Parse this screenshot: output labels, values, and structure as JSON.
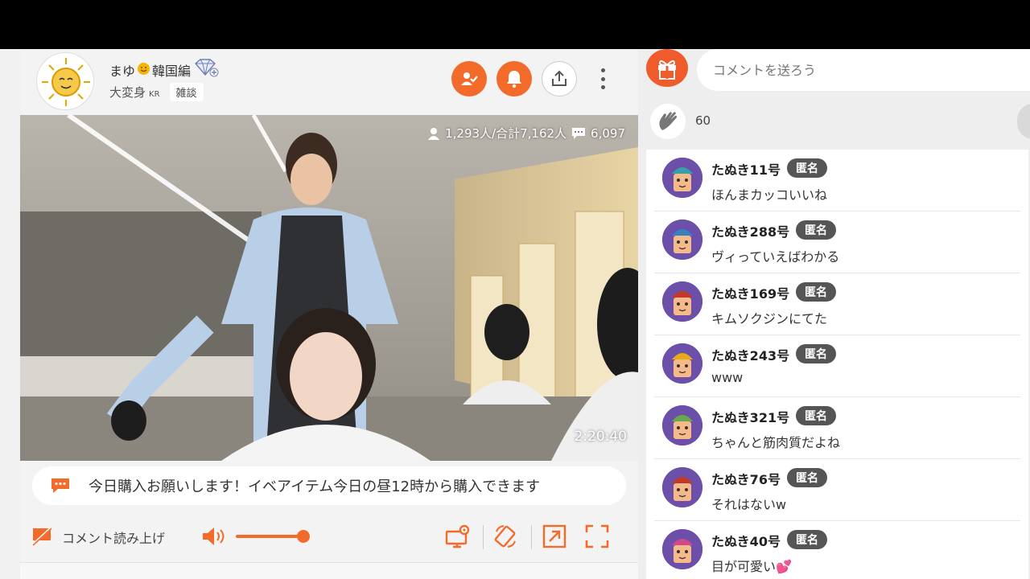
{
  "streamer": {
    "name": "まゆ",
    "name_suffix": "韓国編",
    "subtitle": "大変身",
    "subtitle_region": "KR",
    "tag": "雑談"
  },
  "video": {
    "viewers": "1,293人/合計7,162人",
    "comments_count": "6,097",
    "timecode": "2:20:40"
  },
  "announcement": "今日購入お願いします！イベアイテム今日の昼12時から購入できます",
  "controls": {
    "read_aloud_label": "コメント読み上げ",
    "volume_level": 0.88
  },
  "chat": {
    "input_placeholder": "コメントを送ろう",
    "clap_count": "60",
    "badge_label": "匿名",
    "messages": [
      {
        "user": "たぬき11号",
        "text": "ほんまカッコいいね",
        "cap": "#3aa0a8"
      },
      {
        "user": "たぬき288号",
        "text": "ヴィっていえばわかる",
        "cap": "#3a7fc0"
      },
      {
        "user": "たぬき169号",
        "text": "キムソクジンにてた",
        "cap": "#c0392b"
      },
      {
        "user": "たぬき243号",
        "text": "www",
        "cap": "#e6a817"
      },
      {
        "user": "たぬき321号",
        "text": "ちゃんと筋肉質だよね",
        "cap": "#6aa84f"
      },
      {
        "user": "たぬき76号",
        "text": "それはないw",
        "cap": "#c0392b"
      },
      {
        "user": "たぬき40号",
        "text": "目が可愛い💕",
        "cap": "#d04a8a"
      }
    ]
  },
  "colors": {
    "accent": "#f36b2a",
    "badge": "#555555"
  }
}
